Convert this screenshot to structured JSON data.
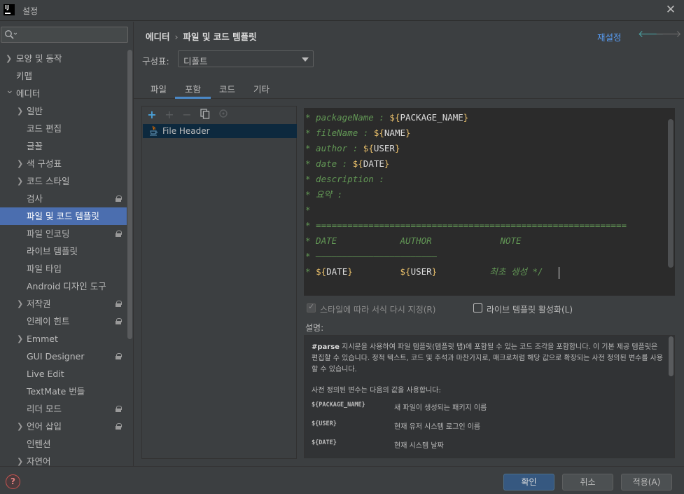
{
  "window": {
    "logo": "IJ",
    "title": "설정",
    "close_icon": "✕"
  },
  "search": {
    "placeholder": ""
  },
  "sidebar": {
    "items": [
      {
        "label": "모양 및 동작",
        "arrow": "❯",
        "level": 0
      },
      {
        "label": "키맵",
        "arrow": "",
        "level": 0
      },
      {
        "label": "에디터",
        "arrow": "⌄",
        "level": 0
      },
      {
        "label": "일반",
        "arrow": "❯",
        "level": 1
      },
      {
        "label": "코드 편집",
        "arrow": "",
        "level": 1
      },
      {
        "label": "글꼴",
        "arrow": "",
        "level": 1
      },
      {
        "label": "색 구성표",
        "arrow": "❯",
        "level": 1
      },
      {
        "label": "코드 스타일",
        "arrow": "❯",
        "level": 1
      },
      {
        "label": "검사",
        "arrow": "",
        "level": 1,
        "lock": true
      },
      {
        "label": "파일 및 코드 템플릿",
        "arrow": "",
        "level": 1,
        "selected": true
      },
      {
        "label": "파일 인코딩",
        "arrow": "",
        "level": 1,
        "lock": true
      },
      {
        "label": "라이브 템플릿",
        "arrow": "",
        "level": 1
      },
      {
        "label": "파일 타입",
        "arrow": "",
        "level": 1
      },
      {
        "label": "Android 디자인 도구",
        "arrow": "",
        "level": 1
      },
      {
        "label": "저작권",
        "arrow": "❯",
        "level": 1,
        "lock": true
      },
      {
        "label": "인레이 힌트",
        "arrow": "",
        "level": 1,
        "lock": true
      },
      {
        "label": "Emmet",
        "arrow": "❯",
        "level": 1
      },
      {
        "label": "GUI Designer",
        "arrow": "",
        "level": 1,
        "lock": true
      },
      {
        "label": "Live Edit",
        "arrow": "",
        "level": 1
      },
      {
        "label": "TextMate 번들",
        "arrow": "",
        "level": 1
      },
      {
        "label": "리더 모드",
        "arrow": "",
        "level": 1,
        "lock": true
      },
      {
        "label": "언어 삽입",
        "arrow": "❯",
        "level": 1,
        "lock": true
      },
      {
        "label": "인텐션",
        "arrow": "",
        "level": 1
      },
      {
        "label": "자연어",
        "arrow": "❯",
        "level": 1
      }
    ]
  },
  "header": {
    "crumb1": "에디터",
    "sep": "›",
    "crumb2": "파일 및 코드 템플릿",
    "reset": "재설정",
    "back_icon": "🡐",
    "forward_icon": "🡒"
  },
  "scheme": {
    "label": "구성표:",
    "value": "디폴트"
  },
  "tabs": [
    {
      "label": "파일"
    },
    {
      "label": "포함",
      "active": true
    },
    {
      "label": "코드"
    },
    {
      "label": "기타"
    }
  ],
  "list": {
    "toolbar": {
      "add": "+",
      "add_child": "+",
      "remove": "−"
    },
    "items": [
      {
        "label": "File Header"
      }
    ]
  },
  "editor": {
    "lines": [
      {
        "pre": "* packageName : ",
        "brace_open": "${",
        "var": "PACKAGE_NAME",
        "brace_close": "}",
        "post": ""
      },
      {
        "pre": "* fileName : ",
        "brace_open": "${",
        "var": "NAME",
        "brace_close": "}",
        "post": ""
      },
      {
        "pre": "* author : ",
        "brace_open": "${",
        "var": "USER",
        "brace_close": "}",
        "post": ""
      },
      {
        "pre": "* date : ",
        "brace_open": "${",
        "var": "DATE",
        "brace_close": "}",
        "post": ""
      },
      {
        "pre": "* description :",
        "brace_open": "",
        "var": "",
        "brace_close": "",
        "post": ""
      },
      {
        "pre": "* 요약 :",
        "brace_open": "",
        "var": "",
        "brace_close": "",
        "post": ""
      },
      {
        "pre": "*",
        "brace_open": "",
        "var": "",
        "brace_close": "",
        "post": ""
      },
      {
        "pre": "* ===========================================================",
        "brace_open": "",
        "var": "",
        "brace_close": "",
        "post": ""
      },
      {
        "pre": "* DATE            AUTHOR             NOTE",
        "brace_open": "",
        "var": "",
        "brace_close": "",
        "post": ""
      },
      {
        "pre": "* ———————————————————————",
        "brace_open": "",
        "var": "",
        "brace_close": "",
        "post": ""
      }
    ],
    "last_line": {
      "star": "* ",
      "b1o": "${",
      "v1": "DATE",
      "b1c": "}",
      "gap1": "         ",
      "b2o": "${",
      "v2": "USER",
      "b2c": "}",
      "gap2": "          ",
      "comment": "최초 생성 */"
    }
  },
  "options": {
    "reformat_label": "스타일에 따라 서식 다시 지정(R)",
    "reformat_checked": true,
    "live_label": "라이브 템플릿 활성화(L)",
    "live_checked": false
  },
  "description": {
    "label": "설명:",
    "bold": "#parse",
    "text1": " 지시문을 사용하여 파일 템플릿(템플릿 탭)에 포함될 수 있는 코드 조각을 포함합니다. 이 기본 제공 템플릿은 편집할 수 있습니다. 정적 텍스트, 코드 및 주석과 마찬가지로, 매크로처럼 해당 값으로 확장되는 사전 정의된 변수를 사용할 수 있습니다.",
    "text2": "사전 정의된 변수는 다음의 값을 사용합니다:",
    "vars": [
      {
        "name": "${PACKAGE_NAME}",
        "desc": "새 파일이 생성되는 패키지 이름"
      },
      {
        "name": "${USER}",
        "desc": "현재 유저 시스템 로그인 이름"
      },
      {
        "name": "${DATE}",
        "desc": "현재 시스템 날짜"
      }
    ]
  },
  "buttons": {
    "help": "?",
    "ok": "확인",
    "cancel": "취소",
    "apply": "적용(A)"
  }
}
